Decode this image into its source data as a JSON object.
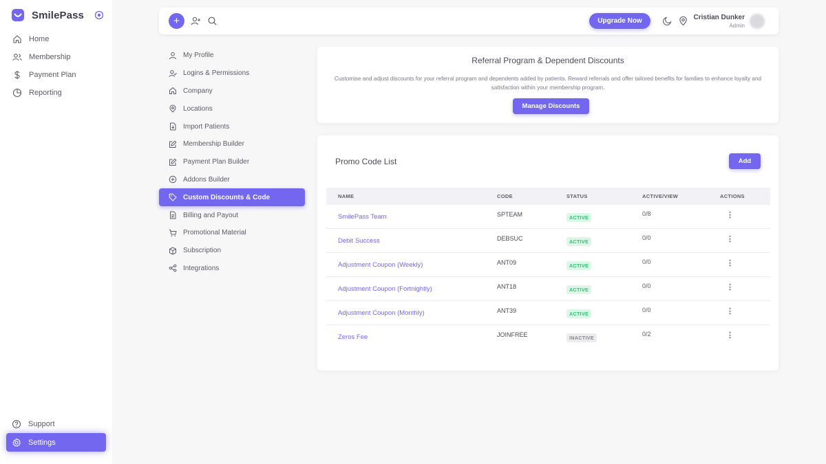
{
  "app": {
    "name": "SmilePass"
  },
  "sidebar": {
    "items": [
      {
        "label": "Home",
        "icon": "home-icon"
      },
      {
        "label": "Membership",
        "icon": "users-icon"
      },
      {
        "label": "Payment Plan",
        "icon": "dollar-icon"
      },
      {
        "label": "Reporting",
        "icon": "pie-chart-icon"
      }
    ],
    "bottom_items": [
      {
        "label": "Support",
        "icon": "help-circle-icon"
      },
      {
        "label": "Settings",
        "icon": "gear-icon",
        "active": true
      }
    ]
  },
  "topbar": {
    "upgrade_label": "Upgrade Now",
    "user_name": "Cristian Dunker",
    "user_role": "Admin"
  },
  "settings_menu": {
    "items": [
      {
        "label": "My Profile",
        "icon": "user-icon"
      },
      {
        "label": "Logins & Permissions",
        "icon": "user-check-icon"
      },
      {
        "label": "Company",
        "icon": "home-icon"
      },
      {
        "label": "Locations",
        "icon": "map-pin-icon"
      },
      {
        "label": "Import Patients",
        "icon": "file-import-icon"
      },
      {
        "label": "Membership Builder",
        "icon": "edit-icon"
      },
      {
        "label": "Payment Plan Builder",
        "icon": "edit-icon"
      },
      {
        "label": "Addons Builder",
        "icon": "plus-circle-icon"
      },
      {
        "label": "Custom Discounts & Code",
        "icon": "tag-icon",
        "active": true
      },
      {
        "label": "Billing and Payout",
        "icon": "file-text-icon"
      },
      {
        "label": "Promotional Material",
        "icon": "cart-icon"
      },
      {
        "label": "Subscription",
        "icon": "box-icon"
      },
      {
        "label": "Integrations",
        "icon": "share-icon"
      }
    ]
  },
  "referral": {
    "title": "Referral Program & Dependent Discounts",
    "description": "Customise and adjust discounts for your referral program and dependents added by patients. Reward referrals and offer tailored benefits for families to enhance loyalty and satisfaction within your membership program.",
    "button_label": "Manage Discounts"
  },
  "promo": {
    "title": "Promo Code List",
    "add_label": "Add",
    "columns": [
      "NAME",
      "CODE",
      "STATUS",
      "ACTIVE/VIEW",
      "ACTIONS"
    ],
    "rows": [
      {
        "name": "SmilePass Team",
        "code": "SPTEAM",
        "status": "ACTIVE",
        "active_view": "0/8"
      },
      {
        "name": "Debit Success",
        "code": "DEBSUC",
        "status": "ACTIVE",
        "active_view": "0/0"
      },
      {
        "name": "Adjustment Coupon (Weekly)",
        "code": "ANT09",
        "status": "ACTIVE",
        "active_view": "0/0"
      },
      {
        "name": "Adjustment Coupon (Fortnightly)",
        "code": "ANT18",
        "status": "ACTIVE",
        "active_view": "0/0"
      },
      {
        "name": "Adjustment Coupon (Monthly)",
        "code": "ANT39",
        "status": "ACTIVE",
        "active_view": "0/0"
      },
      {
        "name": "Zeros Fee",
        "code": "JOINFREE",
        "status": "INACTIVE",
        "active_view": "0/2"
      }
    ],
    "actions_glyph": "⋮"
  },
  "colors": {
    "accent": "#7367f0",
    "active_badge": "#28c76f",
    "inactive_badge": "#82868b"
  }
}
